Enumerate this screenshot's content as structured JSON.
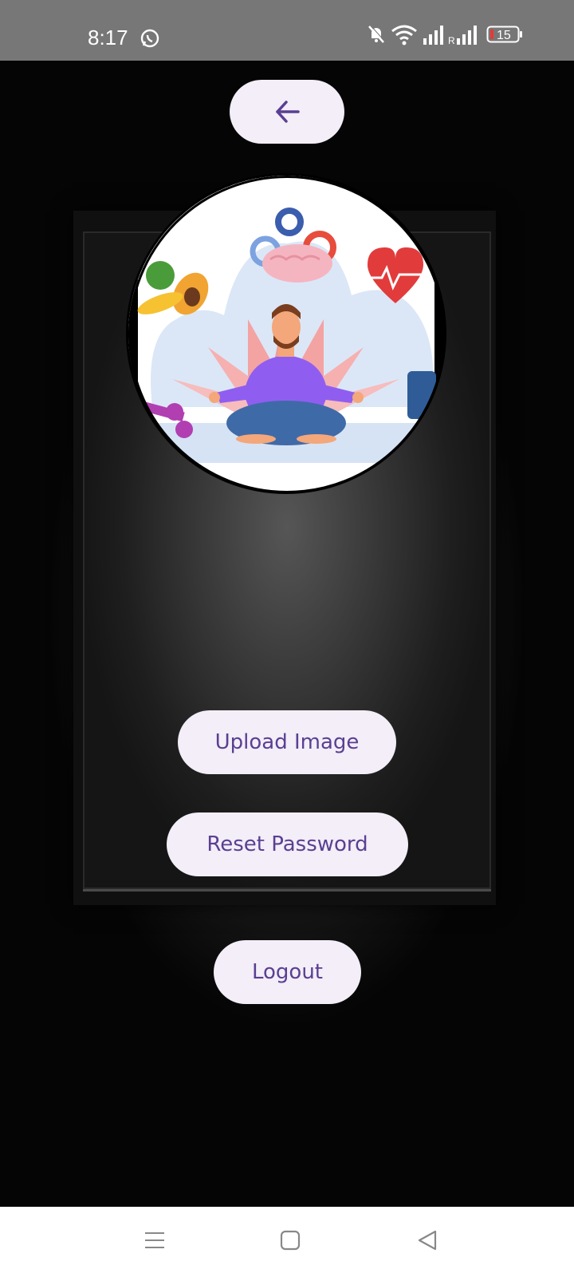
{
  "status_bar": {
    "time": "8:17",
    "battery_level": "15",
    "icons": [
      "whatsapp-icon",
      "mute-icon",
      "wifi-icon",
      "signal-icon",
      "signal-roaming-icon",
      "battery-icon"
    ],
    "roaming_letter": "R"
  },
  "header": {
    "back_icon": "arrow-left-icon"
  },
  "profile": {
    "image_description_icon": "meditation-illustration"
  },
  "actions": {
    "upload_label": "Upload Image",
    "reset_label": "Reset Password",
    "logout_label": "Logout"
  },
  "nav": {
    "icons": [
      "menu-icon",
      "home-icon",
      "back-icon"
    ]
  },
  "colors": {
    "accent": "#5a3f93",
    "button_bg": "#f3eef7",
    "status_bg": "#777777"
  }
}
